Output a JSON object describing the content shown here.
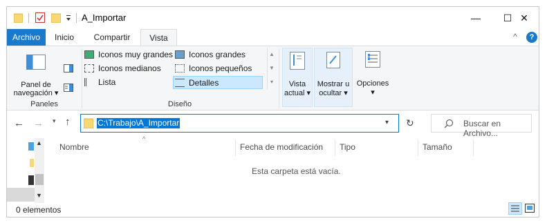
{
  "titlebar": {
    "title": "A_Importar",
    "minimize_glyph": "—",
    "maximize_glyph": "☐",
    "close_glyph": "✕"
  },
  "tabs": {
    "file": "Archivo",
    "home": "Inicio",
    "share": "Compartir",
    "view": "Vista",
    "collapse_glyph": "^",
    "help_glyph": "?"
  },
  "ribbon": {
    "panes": {
      "pane_button_line1": "Panel de",
      "pane_button_line2": "navegación",
      "group_label": "Paneles"
    },
    "layout": {
      "items": [
        "Iconos muy grandes",
        "Iconos grandes",
        "Iconos medianos",
        "Iconos pequeños",
        "Lista",
        "Detalles"
      ],
      "selected": "Detalles",
      "group_label": "Diseño"
    },
    "current_view": {
      "line1": "Vista",
      "line2": "actual"
    },
    "show_hide": {
      "line1": "Mostrar u",
      "line2": "ocultar"
    },
    "options": {
      "label": "Opciones"
    }
  },
  "address": {
    "path": "C:\\Trabajo\\A_Importar",
    "search_placeholder": "Buscar en Archivo..."
  },
  "columns": [
    "Nombre",
    "Fecha de modificación",
    "Tipo",
    "Tamaño"
  ],
  "empty_message": "Esta carpeta está vacía.",
  "status": {
    "count": "0 elementos"
  },
  "colors": {
    "accent": "#1979ca",
    "selection": "#0078d7",
    "help": "#1979ca",
    "folder": "#f8d775"
  }
}
